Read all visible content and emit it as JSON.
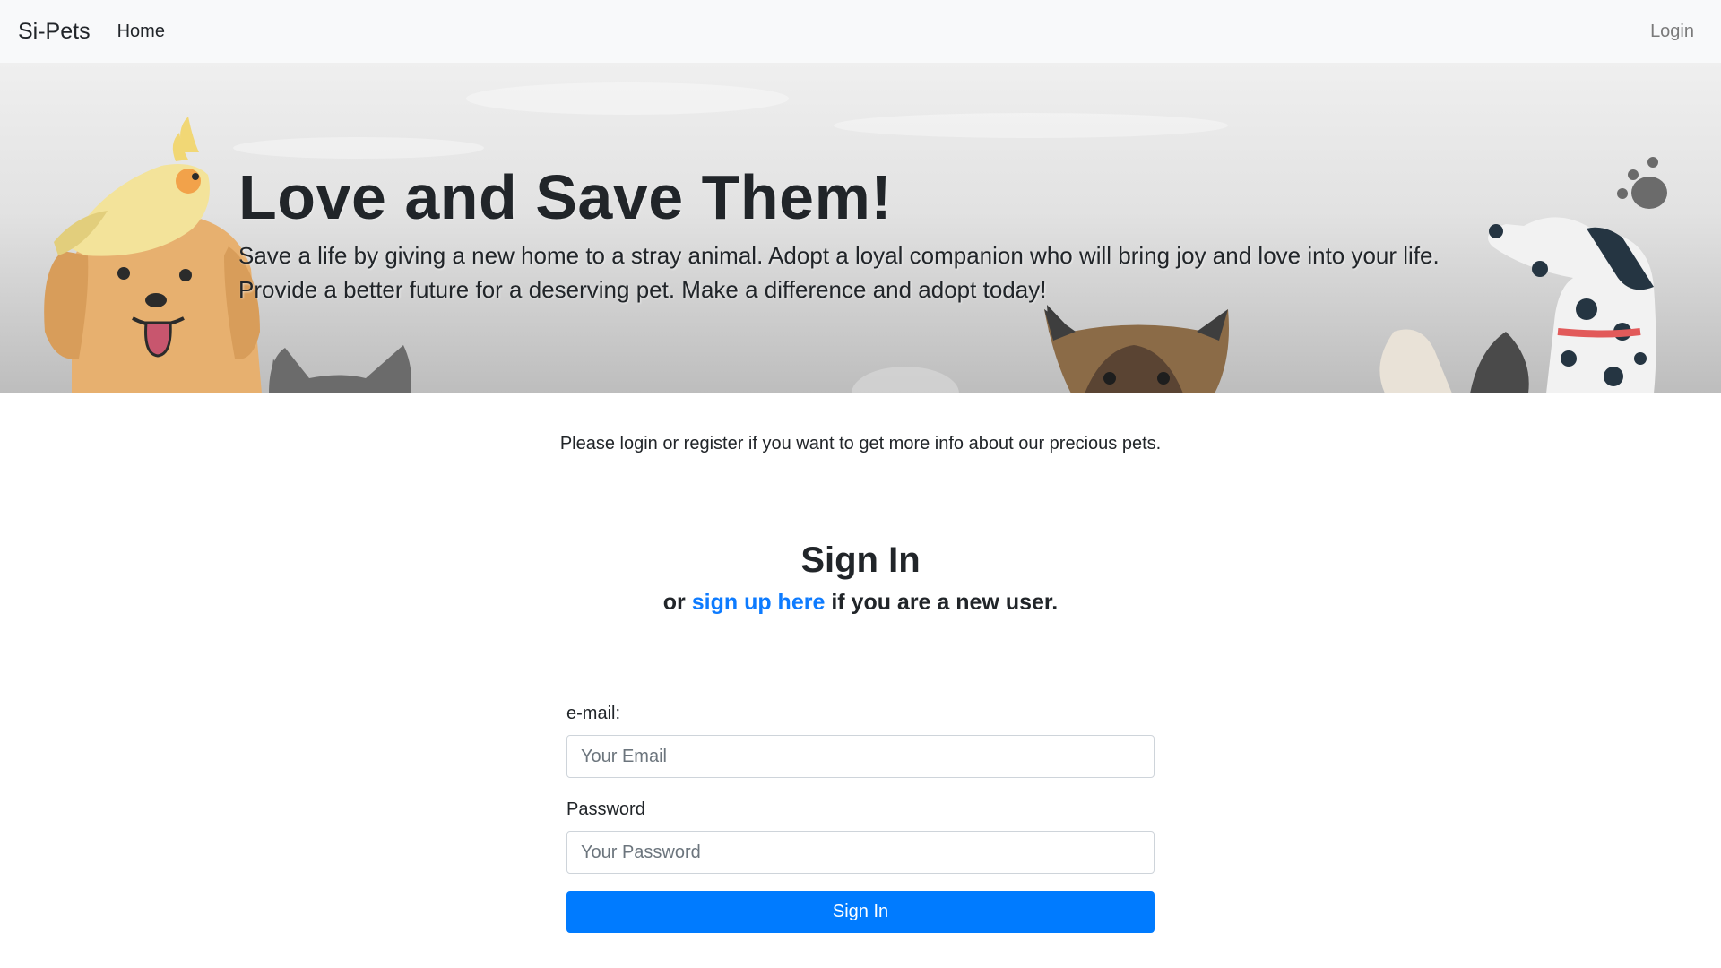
{
  "navbar": {
    "brand": "Si-Pets",
    "home_label": "Home",
    "login_label": "Login"
  },
  "hero": {
    "title": "Love and Save Them!",
    "lead": "Save a life by giving a new home to a stray animal. Adopt a loyal companion who will bring joy and love into your life. Provide a better future for a deserving pet. Make a difference and adopt today!"
  },
  "info": {
    "text": "Please login or register if you want to get more info about our precious pets."
  },
  "signin": {
    "title": "Sign In",
    "subtitle_prefix": "or ",
    "signup_link": "sign up here",
    "subtitle_suffix": " if you are a new user.",
    "email_label": "e-mail:",
    "email_placeholder": "Your Email",
    "email_value": "",
    "password_label": "Password",
    "password_placeholder": "Your Password",
    "password_value": "",
    "button_label": "Sign In"
  },
  "colors": {
    "primary": "#007bff",
    "link": "#0d7bff",
    "navbar_bg": "#f8f9fa"
  }
}
